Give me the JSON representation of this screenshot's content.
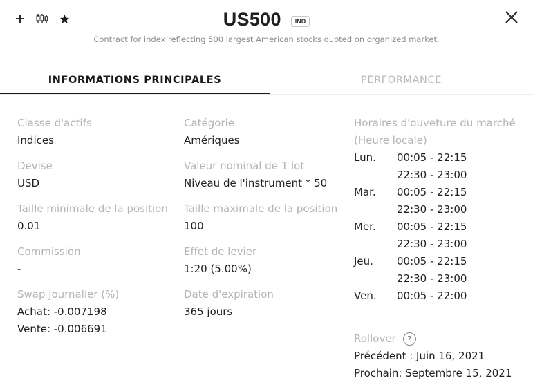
{
  "header": {
    "title": "US500",
    "badge": "IND",
    "subtitle": "Contract for index reflecting 500 largest American stocks quoted on organized market.",
    "icons": [
      "plus-icon",
      "candlestick-chart-icon",
      "star-icon",
      "close-icon"
    ]
  },
  "tabs": [
    {
      "label": "INFORMATIONS PRINCIPALES",
      "active": true
    },
    {
      "label": "PERFORMANCE",
      "active": false
    }
  ],
  "col1": {
    "asset_class": {
      "label": "Classe d'actifs",
      "value": "Indices"
    },
    "currency": {
      "label": "Devise",
      "value": "USD"
    },
    "min_size": {
      "label": "Taille minimale de la position",
      "value": "0.01"
    },
    "commission": {
      "label": "Commission",
      "value": "-"
    },
    "swap": {
      "label": "Swap journalier (%)",
      "buy": "Achat: -0.007198",
      "sell": "Vente: -0.006691"
    }
  },
  "col2": {
    "category": {
      "label": "Catégorie",
      "value": "Amériques"
    },
    "lot_value": {
      "label": "Valeur nominal de 1 lot",
      "value": "Niveau de l'instrument * 50"
    },
    "max_size": {
      "label": "Taille maximale de la position",
      "value": "100"
    },
    "leverage": {
      "label": "Effet de levier",
      "value": "1:20 (5.00%)"
    },
    "expiry": {
      "label": "Date d'expiration",
      "value": "365 jours"
    }
  },
  "col3": {
    "hours_label": "Horaires d'ouveture du marché (Heure locale)",
    "schedule": [
      {
        "day": "Lun.",
        "slots": [
          "00:05 - 22:15",
          "22:30 - 23:00"
        ]
      },
      {
        "day": "Mar.",
        "slots": [
          "00:05 - 22:15",
          "22:30 - 23:00"
        ]
      },
      {
        "day": "Mer.",
        "slots": [
          "00:05 - 22:15",
          "22:30 - 23:00"
        ]
      },
      {
        "day": "Jeu.",
        "slots": [
          "00:05 - 22:15",
          "22:30 - 23:00"
        ]
      },
      {
        "day": "Ven.",
        "slots": [
          "00:05 - 22:00"
        ]
      }
    ],
    "rollover": {
      "label": "Rollover",
      "help": "?",
      "previous": "Précédent : Juin 16, 2021",
      "next": "Prochain: Septembre 15, 2021"
    }
  }
}
